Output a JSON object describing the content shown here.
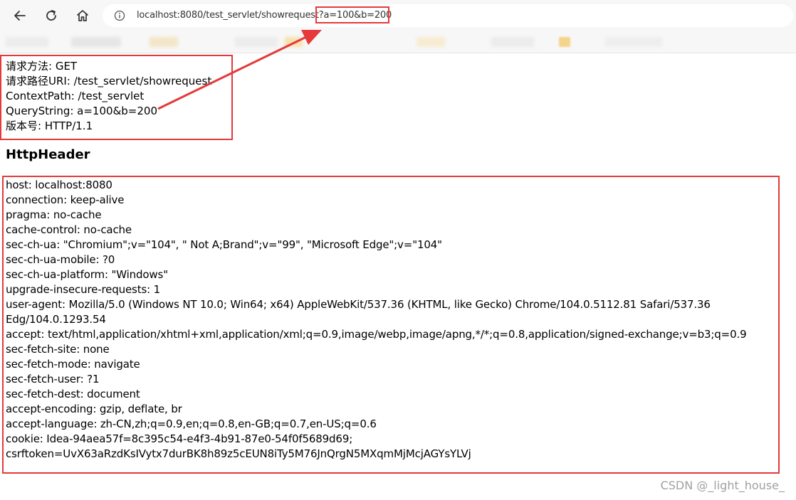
{
  "browser": {
    "url": "localhost:8080/test_servlet/showrequest?a=100&b=200",
    "accent_color": "#e5393a"
  },
  "icons": {
    "back": "back-arrow-icon",
    "reload": "reload-icon",
    "home": "home-icon",
    "info": "info-icon"
  },
  "request_info": [
    "请求方法: GET",
    "请求路径URI: /test_servlet/showrequest",
    "ContextPath: /test_servlet",
    "QueryString: a=100&b=200",
    "版本号: HTTP/1.1"
  ],
  "section_title": "HttpHeader",
  "headers": [
    "host: localhost:8080",
    "connection: keep-alive",
    "pragma: no-cache",
    "cache-control: no-cache",
    "sec-ch-ua: \"Chromium\";v=\"104\", \" Not A;Brand\";v=\"99\", \"Microsoft Edge\";v=\"104\"",
    "sec-ch-ua-mobile: ?0",
    "sec-ch-ua-platform: \"Windows\"",
    "upgrade-insecure-requests: 1",
    "user-agent: Mozilla/5.0 (Windows NT 10.0; Win64; x64) AppleWebKit/537.36 (KHTML, like Gecko) Chrome/104.0.5112.81 Safari/537.36 Edg/104.0.1293.54",
    "accept: text/html,application/xhtml+xml,application/xml;q=0.9,image/webp,image/apng,*/*;q=0.8,application/signed-exchange;v=b3;q=0.9",
    "sec-fetch-site: none",
    "sec-fetch-mode: navigate",
    "sec-fetch-user: ?1",
    "sec-fetch-dest: document",
    "accept-encoding: gzip, deflate, br",
    "accept-language: zh-CN,zh;q=0.9,en;q=0.8,en-GB;q=0.7,en-US;q=0.6",
    "cookie: Idea-94aea57f=8c395c54-e4f3-4b91-87e0-54f0f5689d69; csrftoken=UvX63aRzdKsIVytx7durBK8h89z5cEUN8iTy5M76JnQrgN5MXqmMjMcjAGYsYLVj"
  ],
  "watermark": "CSDN @_light_house_"
}
